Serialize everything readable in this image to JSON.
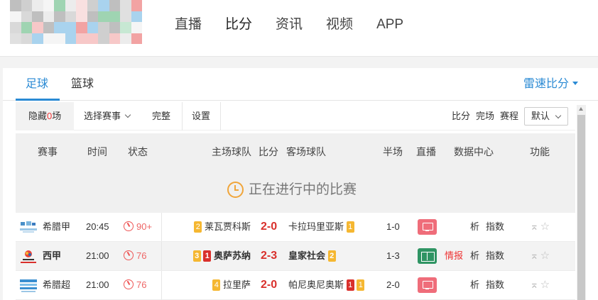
{
  "nav": {
    "items": [
      "直播",
      "比分",
      "资讯",
      "视频",
      "APP"
    ],
    "active": "比分"
  },
  "sport_tabs": {
    "football": "足球",
    "basketball": "篮球",
    "speed_score": "雷速比分"
  },
  "filter_bar": {
    "hide_prefix": "隐藏",
    "hide_count": "0",
    "hide_suffix": "场",
    "select_event": "选择赛事",
    "complete": "完整",
    "settings": "设置",
    "right_score": "比分",
    "right_finished": "完场",
    "right_schedule": "赛程",
    "default_select": "默认"
  },
  "table_header": {
    "event": "赛事",
    "time": "时间",
    "status": "状态",
    "home": "主场球队",
    "score": "比分",
    "away": "客场球队",
    "half": "半场",
    "live": "直播",
    "data_center": "数据中心",
    "function": "功能"
  },
  "live_banner": "正在进行中的比赛",
  "matches": [
    {
      "league": "希腊甲",
      "time": "20:45",
      "minute": "90+",
      "home_red": "",
      "home_yellow": "2",
      "home": "莱瓦贾科斯",
      "score": "2-0",
      "away": "卡拉玛里亚斯",
      "away_red": "",
      "away_yellow": "1",
      "half": "1-0",
      "live_type": "tv",
      "intel": "",
      "analysis": "析",
      "index": "指数"
    },
    {
      "league": "西甲",
      "time": "21:00",
      "minute": "76",
      "home_red": "1",
      "home_yellow": "3",
      "home": "奥萨苏纳",
      "score": "2-3",
      "away": "皇家社会",
      "away_red": "",
      "away_yellow": "2",
      "half": "1-3",
      "live_type": "pitch",
      "intel": "情报",
      "analysis": "析",
      "index": "指数"
    },
    {
      "league": "希腊超",
      "time": "21:00",
      "minute": "76",
      "home_red": "",
      "home_yellow": "4",
      "home": "拉里萨",
      "score": "2-0",
      "away": "帕尼奥尼奥斯",
      "away_red": "1",
      "away_yellow": "1",
      "half": "2-0",
      "live_type": "tv",
      "intel": "",
      "analysis": "析",
      "index": "指数"
    }
  ],
  "colors": {
    "accent": "#2a8ad4",
    "score_red": "#d9302c",
    "yellow_card": "#f5b731",
    "red_card": "#d9302c",
    "tv_pink": "#ef6d7a",
    "pitch_green": "#2f9463"
  }
}
